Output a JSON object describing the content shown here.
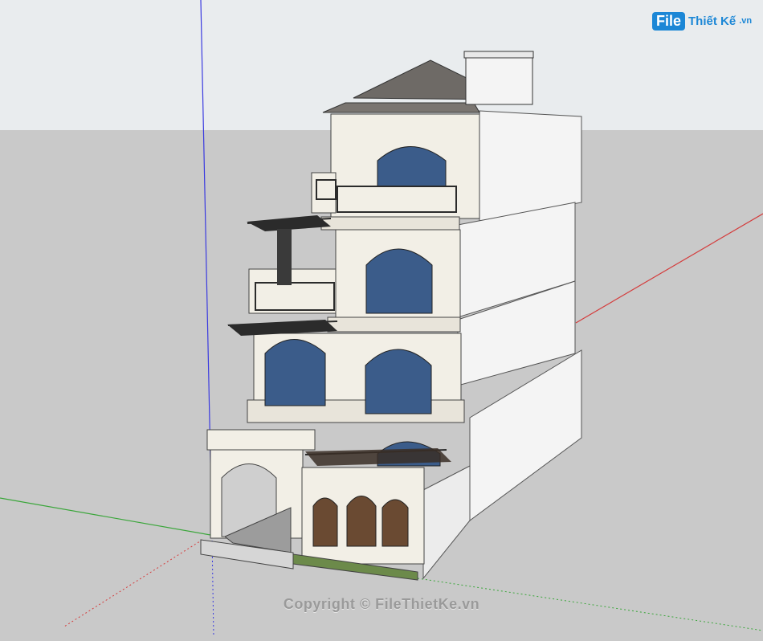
{
  "viewport": {
    "sky_color": "#e9ecee",
    "ground_color": "#c9c9c9",
    "axis_red": "#d43c3c",
    "axis_green": "#3aa63a",
    "axis_blue": "#3a3ae0"
  },
  "watermark": {
    "logo_part1": "File",
    "logo_part2": "Thiết Kế",
    "logo_part3": ".vn",
    "copyright": "Copyright © FileThietKe.vn"
  },
  "model": {
    "wall_color": "#f2efe6",
    "side_color": "#f4f4f4",
    "roof_color": "#6e6a66",
    "glass_color": "#3b5c8a",
    "rail_color": "#2b2b2b"
  }
}
